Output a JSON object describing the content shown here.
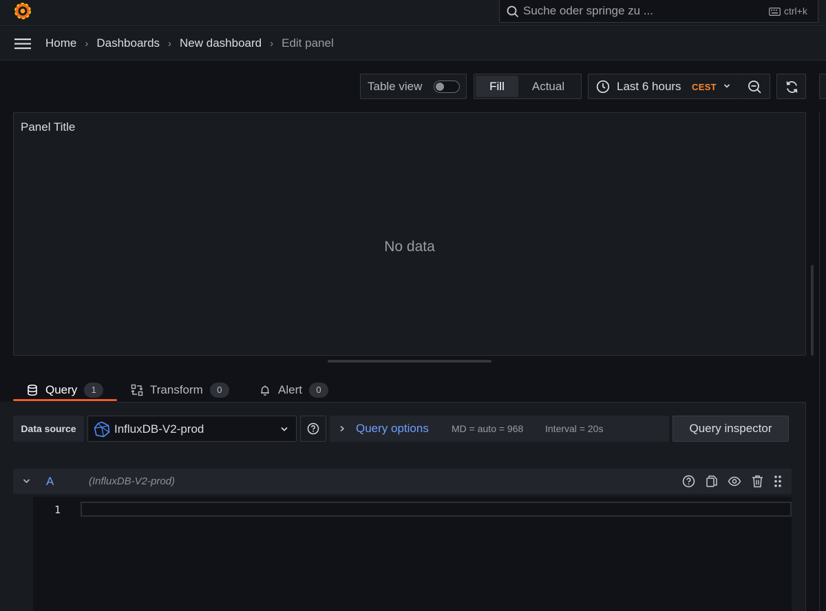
{
  "topbar": {
    "logo_icon": "grafana-logo-icon",
    "search": {
      "placeholder": "Suche oder springe zu ...",
      "shortcut": "ctrl+k"
    }
  },
  "breadcrumb": {
    "items": [
      {
        "label": "Home"
      },
      {
        "label": "Dashboards"
      },
      {
        "label": "New dashboard"
      },
      {
        "label": "Edit panel"
      }
    ]
  },
  "toolbar": {
    "table_view_label": "Table view",
    "table_view_on": false,
    "fill_label": "Fill",
    "actual_label": "Actual",
    "time_range_label": "Last 6 hours",
    "timezone": "CEST"
  },
  "panel": {
    "title": "Panel Title",
    "empty_text": "No data"
  },
  "tabs": [
    {
      "label": "Query",
      "count": "1",
      "icon": "database-icon"
    },
    {
      "label": "Transform",
      "count": "0",
      "icon": "transform-icon"
    },
    {
      "label": "Alert",
      "count": "0",
      "icon": "bell-icon"
    }
  ],
  "datasource": {
    "label": "Data source",
    "selected": "InfluxDB-V2-prod",
    "query_options_label": "Query options",
    "md_info": "MD = auto = 968",
    "interval_info": "Interval = 20s",
    "inspector_label": "Query inspector"
  },
  "query": {
    "ref_id": "A",
    "datasource_name": "(InfluxDB-V2-prod)",
    "line_number": "1"
  },
  "colors": {
    "accent": "#f05a28",
    "link": "#6e9fff",
    "timezone": "#ff8833"
  }
}
